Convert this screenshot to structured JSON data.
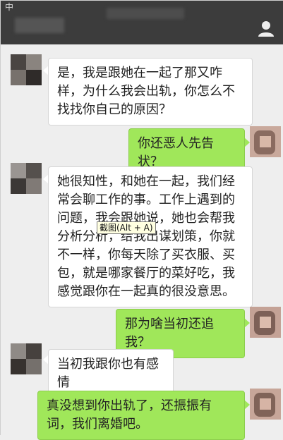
{
  "status_bar": {
    "text": "中"
  },
  "header": {
    "icon": "person-icon"
  },
  "messages": [
    {
      "side": "left",
      "text": "是，我是跟她在一起了那又咋样，为什么我会出轨，你怎么不找找你自己的原因？"
    },
    {
      "side": "right",
      "text": "你还恶人先告状？"
    },
    {
      "side": "left",
      "text": "她很知性，和她在一起，我们经常会聊工作的事。工作上遇到的问题，我会跟她说，她也会帮我分析分析，给我出谋划策，你就不一样，你每天除了买衣服、买包，就是哪家餐厅的菜好吃，我感觉跟你在一起真的很没意思。"
    },
    {
      "side": "right",
      "text": "那为啥当初还追我？"
    },
    {
      "side": "left",
      "text": "当初我跟你也有感情"
    },
    {
      "side": "right",
      "text": "真没想到你出轨了，还振振有词，我们离婚吧。"
    }
  ],
  "tooltip": {
    "text": "截图(Alt + A)"
  },
  "colors": {
    "left_bubble": "#ffffff",
    "right_bubble": "#a0e75a",
    "background": "#eeeeee"
  }
}
